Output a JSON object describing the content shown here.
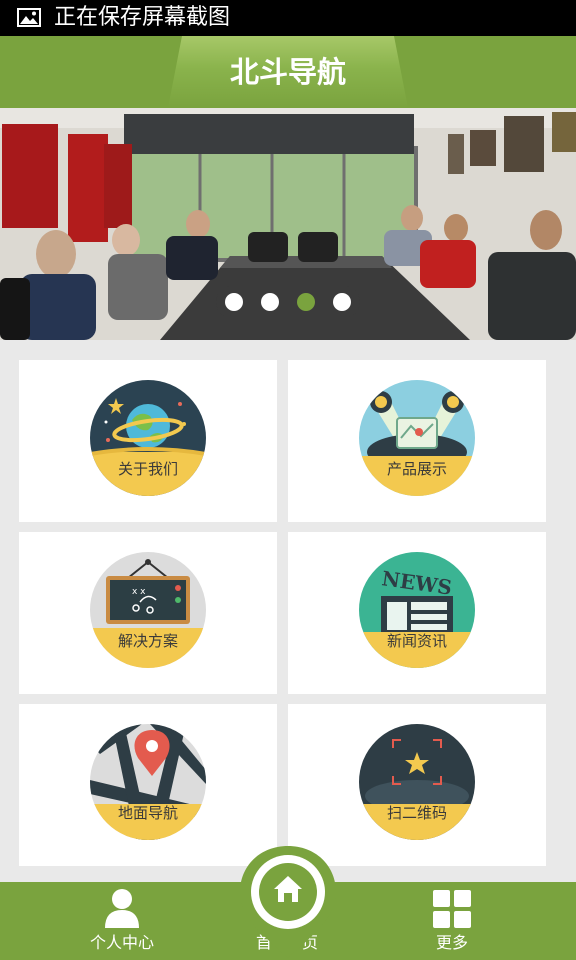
{
  "status_bar": {
    "text": "正在保存屏幕截图",
    "icon": "image-icon"
  },
  "header": {
    "title": "北斗导航"
  },
  "banner": {
    "slide_count": 4,
    "active_slide_index": 2
  },
  "grid": [
    {
      "label": "关于我们",
      "icon": "planet-icon"
    },
    {
      "label": "产品展示",
      "icon": "map-board-icon"
    },
    {
      "label": "解决方案",
      "icon": "strategy-board-icon"
    },
    {
      "label": "新闻资讯",
      "icon": "news-icon"
    },
    {
      "label": "地面导航",
      "icon": "map-pin-icon"
    },
    {
      "label": "扫二维码",
      "icon": "qr-scan-icon"
    }
  ],
  "bottom_nav": {
    "profile": "个人中心",
    "home_left": "首",
    "home_right": "页",
    "more": "更多"
  },
  "colors": {
    "brand_green": "#7aa33e",
    "medal_yellow": "#f3c94f",
    "background": "#e9e9e9"
  }
}
